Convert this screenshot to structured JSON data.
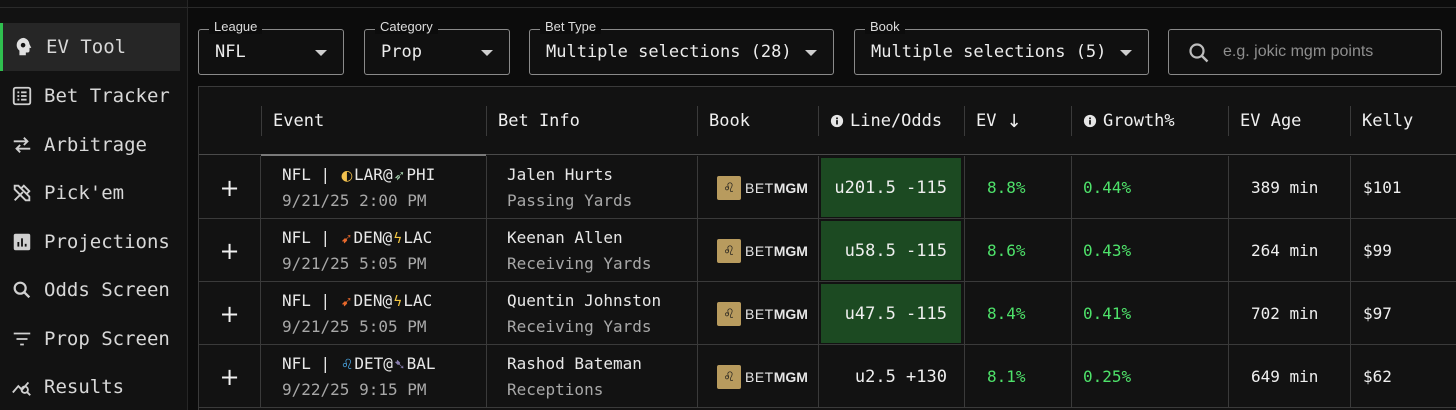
{
  "sidebar": {
    "items": [
      {
        "label": "EV Tool",
        "icon": "brain-head-icon",
        "active": true
      },
      {
        "label": "Bet Tracker",
        "icon": "list-icon",
        "active": false
      },
      {
        "label": "Arbitrage",
        "icon": "swap-arrows-icon",
        "active": false
      },
      {
        "label": "Pick'em",
        "icon": "tools-icon",
        "active": false
      },
      {
        "label": "Projections",
        "icon": "bar-chart-icon",
        "active": false
      },
      {
        "label": "Odds Screen",
        "icon": "magnifier-icon",
        "active": false
      },
      {
        "label": "Prop Screen",
        "icon": "filter-lines-icon",
        "active": false
      },
      {
        "label": "Results",
        "icon": "trend-search-icon",
        "active": false
      }
    ]
  },
  "filters": {
    "league": {
      "label": "League",
      "value": "NFL"
    },
    "category": {
      "label": "Category",
      "value": "Prop"
    },
    "bet_type": {
      "label": "Bet Type",
      "value": "Multiple selections (28)"
    },
    "book": {
      "label": "Book",
      "value": "Multiple selections (5)"
    },
    "search": {
      "placeholder": "e.g. jokic mgm points"
    }
  },
  "table": {
    "headers": {
      "event": "Event",
      "bet_info": "Bet Info",
      "book": "Book",
      "line_odds": "Line/Odds",
      "ev": "EV",
      "growth": "Growth%",
      "ev_age": "EV Age",
      "kelly": "Kelly"
    },
    "rows": [
      {
        "league": "NFL |",
        "away": "LAR",
        "sep": "@",
        "home": "PHI",
        "away_icon": "rams-logo",
        "home_icon": "eagles-logo",
        "datetime": "9/21/25 2:00 PM",
        "player": "Jalen Hurts",
        "market": "Passing Yards",
        "book_bet": "BET",
        "book_mgm": "MGM",
        "line_odds": "u201.5 -115",
        "highlight": true,
        "ev": "8.8%",
        "growth": "0.44%",
        "ev_age": "389 min",
        "kelly": "$101"
      },
      {
        "league": "NFL |",
        "away": "DEN",
        "sep": "@",
        "home": "LAC",
        "away_icon": "broncos-logo",
        "home_icon": "chargers-logo",
        "datetime": "9/21/25 5:05 PM",
        "player": "Keenan Allen",
        "market": "Receiving Yards",
        "book_bet": "BET",
        "book_mgm": "MGM",
        "line_odds": "u58.5 -115",
        "highlight": true,
        "ev": "8.6%",
        "growth": "0.43%",
        "ev_age": "264 min",
        "kelly": "$99"
      },
      {
        "league": "NFL |",
        "away": "DEN",
        "sep": "@",
        "home": "LAC",
        "away_icon": "broncos-logo",
        "home_icon": "chargers-logo",
        "datetime": "9/21/25 5:05 PM",
        "player": "Quentin Johnston",
        "market": "Receiving Yards",
        "book_bet": "BET",
        "book_mgm": "MGM",
        "line_odds": "u47.5 -115",
        "highlight": true,
        "ev": "8.4%",
        "growth": "0.41%",
        "ev_age": "702 min",
        "kelly": "$97"
      },
      {
        "league": "NFL |",
        "away": "DET",
        "sep": "@",
        "home": "BAL",
        "away_icon": "lions-logo",
        "home_icon": "ravens-logo",
        "datetime": "9/22/25 9:15 PM",
        "player": "Rashod Bateman",
        "market": "Receptions",
        "book_bet": "BET",
        "book_mgm": "MGM",
        "line_odds": "u2.5 +130",
        "highlight": false,
        "ev": "8.1%",
        "growth": "0.25%",
        "ev_age": "649 min",
        "kelly": "$62"
      }
    ]
  },
  "colors": {
    "accent_green": "#2fbf4f",
    "positive_text": "#4ee26a",
    "highlight_cell": "#1c4a22"
  }
}
